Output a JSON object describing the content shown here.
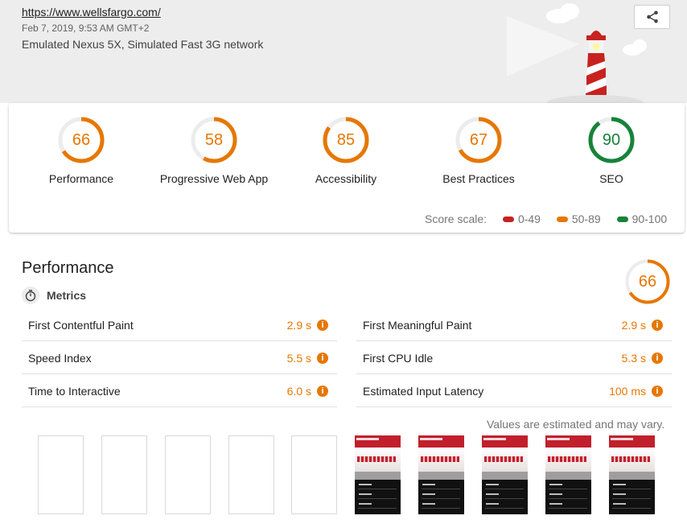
{
  "header": {
    "url": "https://www.wellsfargo.com/",
    "date": "Feb 7, 2019, 9:53 AM GMT+2",
    "environment": "Emulated Nexus 5X, Simulated Fast 3G network",
    "share_icon": "share-icon"
  },
  "colors": {
    "fail": "#c7221f",
    "average": "#e67700",
    "pass": "#178239",
    "accent_text": "#e67700"
  },
  "categories": [
    {
      "label": "Performance",
      "score": "66",
      "rating": "average"
    },
    {
      "label": "Progressive Web App",
      "score": "58",
      "rating": "average"
    },
    {
      "label": "Accessibility",
      "score": "85",
      "rating": "average"
    },
    {
      "label": "Best Practices",
      "score": "67",
      "rating": "average"
    },
    {
      "label": "SEO",
      "score": "90",
      "rating": "pass"
    }
  ],
  "scale": {
    "label": "Score scale:",
    "ranges": [
      {
        "label": "0-49",
        "rating": "fail"
      },
      {
        "label": "50-89",
        "rating": "average"
      },
      {
        "label": "90-100",
        "rating": "pass"
      }
    ]
  },
  "performance": {
    "title": "Performance",
    "score": "66",
    "metrics_label": "Metrics",
    "metrics": [
      {
        "label": "First Contentful Paint",
        "value": "2.9 s"
      },
      {
        "label": "First Meaningful Paint",
        "value": "2.9 s"
      },
      {
        "label": "Speed Index",
        "value": "5.5 s"
      },
      {
        "label": "First CPU Idle",
        "value": "5.3 s"
      },
      {
        "label": "Time to Interactive",
        "value": "6.0 s"
      },
      {
        "label": "Estimated Input Latency",
        "value": "100 ms"
      }
    ],
    "note": "Values are estimated and may vary.",
    "filmstrip": [
      "blank",
      "blank",
      "blank",
      "blank",
      "blank",
      "loaded",
      "loaded",
      "loaded",
      "loaded",
      "loaded"
    ]
  }
}
